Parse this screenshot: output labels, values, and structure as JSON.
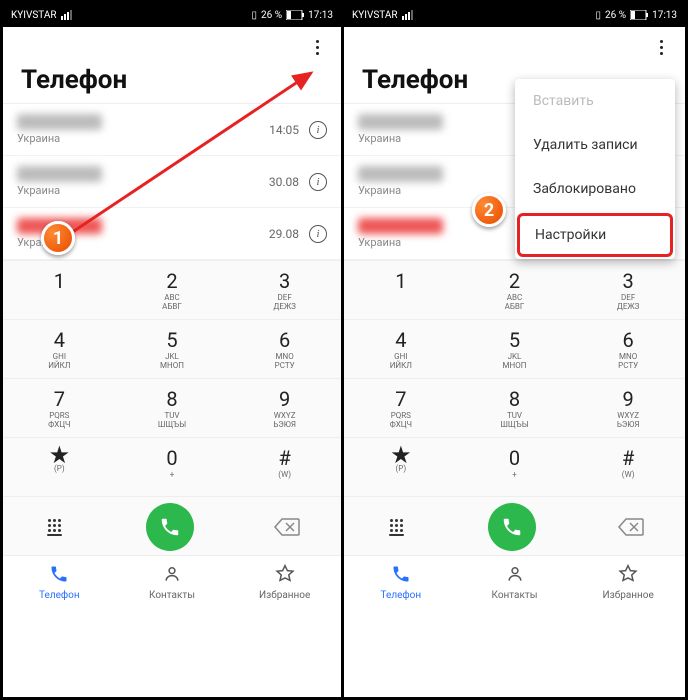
{
  "statusbar": {
    "carrier": "KYIVSTAR",
    "battery": "26 %",
    "time": "17:13"
  },
  "header": {
    "title": "Телефон"
  },
  "calls": [
    {
      "location": "Украина",
      "time": "14:05",
      "red": false
    },
    {
      "location": "Украина",
      "time": "30.08",
      "red": false
    },
    {
      "location": "Украина",
      "time": "29.08",
      "red": true
    }
  ],
  "dialpad": [
    {
      "digit": "1",
      "sub1": "",
      "sub2": ""
    },
    {
      "digit": "2",
      "sub1": "ABC",
      "sub2": "АБВГ"
    },
    {
      "digit": "3",
      "sub1": "DEF",
      "sub2": "ДЕЖЗ"
    },
    {
      "digit": "4",
      "sub1": "GHI",
      "sub2": "ИЙКЛ"
    },
    {
      "digit": "5",
      "sub1": "JKL",
      "sub2": "МНОП"
    },
    {
      "digit": "6",
      "sub1": "MNO",
      "sub2": "РСТУ"
    },
    {
      "digit": "7",
      "sub1": "PQRS",
      "sub2": "ФХЦЧ"
    },
    {
      "digit": "8",
      "sub1": "TUV",
      "sub2": "ШЩЪЫ"
    },
    {
      "digit": "9",
      "sub1": "WXYZ",
      "sub2": "ЬЭЮЯ"
    },
    {
      "digit": "★",
      "sub1": "(P)",
      "sub2": ""
    },
    {
      "digit": "0",
      "sub1": "+",
      "sub2": ""
    },
    {
      "digit": "#",
      "sub1": "(W)",
      "sub2": ""
    }
  ],
  "bottom_nav": [
    {
      "label": "Телефон",
      "active": true,
      "icon": "phone"
    },
    {
      "label": "Контакты",
      "active": false,
      "icon": "contacts"
    },
    {
      "label": "Избранное",
      "active": false,
      "icon": "star"
    }
  ],
  "dropdown": [
    {
      "label": "Вставить",
      "disabled": true
    },
    {
      "label": "Удалить записи",
      "disabled": false
    },
    {
      "label": "Заблокировано",
      "disabled": false
    },
    {
      "label": "Настройки",
      "disabled": false,
      "highlighted": true
    }
  ],
  "markers": {
    "one": "1",
    "two": "2"
  }
}
